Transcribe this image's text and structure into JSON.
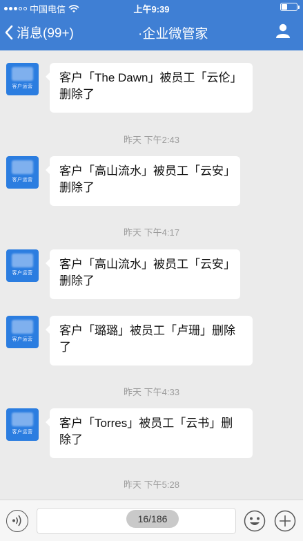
{
  "status_bar": {
    "carrier": "中国电信",
    "time": "上午9:39"
  },
  "header": {
    "back_label": "消息(99+)",
    "title": "·企业微管家"
  },
  "avatar_label": "客户运营",
  "messages": [
    {
      "text": "客户「The Dawn」被员工「云伦」删除了"
    },
    {
      "timestamp": "昨天 下午2:43"
    },
    {
      "text": "客户「高山流水」被员工「云安」删除了"
    },
    {
      "timestamp": "昨天 下午4:17"
    },
    {
      "text": "客户「高山流水」被员工「云安」删除了"
    },
    {
      "text": "客户「璐璐」被员工「卢珊」删除了"
    },
    {
      "timestamp": "昨天 下午4:33"
    },
    {
      "text": "客户「Torres」被员工「云书」删除了"
    },
    {
      "timestamp": "昨天 下午5:28"
    }
  ],
  "pager": {
    "text": "16/186"
  },
  "icons": {
    "back": "chevron-left-icon",
    "user": "user-icon",
    "voice": "voice-icon",
    "emoji": "emoji-icon",
    "plus": "plus-icon"
  },
  "colors": {
    "header": "#3f7fd4",
    "avatar": "#2b7de0",
    "background": "#ebebeb"
  }
}
